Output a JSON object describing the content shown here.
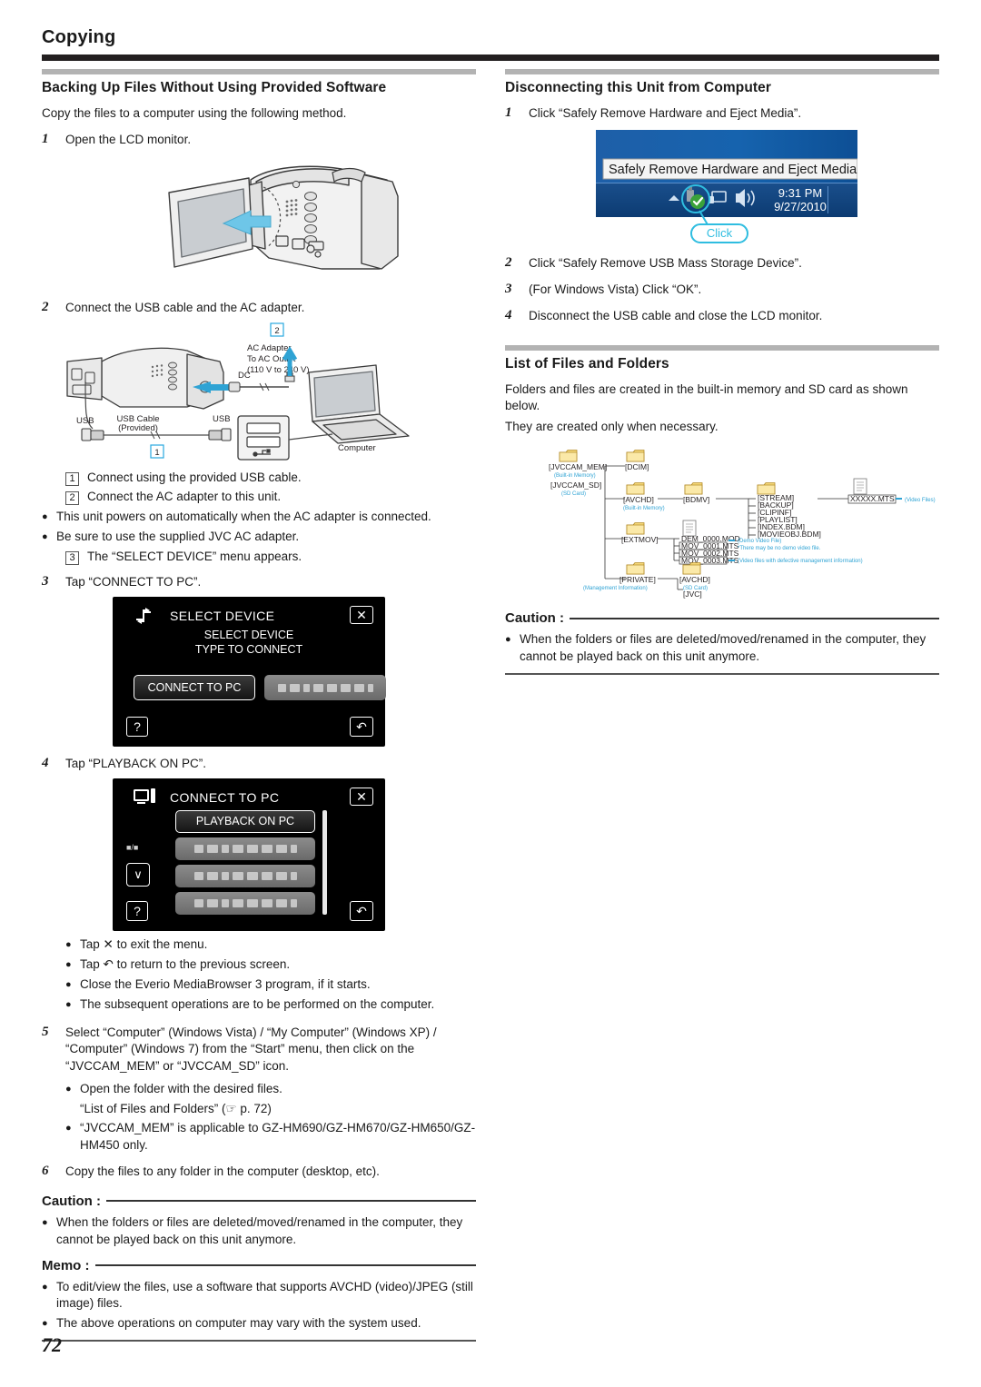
{
  "chapter": {
    "title": "Copying",
    "page_number": "72"
  },
  "left": {
    "section_title": "Backing Up Files Without Using Provided Software",
    "intro": "Copy the files to a computer using the following method.",
    "step1": {
      "num": "1",
      "text": "Open the LCD monitor."
    },
    "step2": {
      "num": "2",
      "text": "Connect the USB cable and the AC adapter."
    },
    "usb_diagram": {
      "badge1": "1",
      "badge2": "2",
      "ac_adapter_l1": "AC Adapter",
      "ac_adapter_l2": "To AC Outlet",
      "ac_adapter_l3": "(110 V to 240 V)",
      "dc": "DC",
      "usb_left": "USB",
      "usb_right": "USB",
      "usb_cable_l1": "USB Cable",
      "usb_cable_l2": "(Provided)",
      "computer": "Computer"
    },
    "substeps": [
      {
        "num": "1",
        "text": "Connect using the provided USB cable."
      },
      {
        "num": "2",
        "text": "Connect the AC adapter to this unit."
      }
    ],
    "bullets_after_substeps": [
      "This unit powers on automatically when the AC adapter is connected.",
      "Be sure to use the supplied JVC AC adapter."
    ],
    "substep3": {
      "num": "3",
      "text": "The “SELECT DEVICE” menu appears."
    },
    "step3": {
      "num": "3",
      "text": "Tap “CONNECT TO PC”."
    },
    "lcd_select_device": {
      "title": "SELECT DEVICE",
      "sub_line1": "SELECT DEVICE",
      "sub_line2": "TYPE TO CONNECT",
      "button": "CONNECT TO PC",
      "close": "✕",
      "back": "↶",
      "help": "?"
    },
    "step4": {
      "num": "4",
      "text": "Tap “PLAYBACK ON PC”."
    },
    "lcd_connect_to_pc": {
      "title": "CONNECT TO PC",
      "button": "PLAYBACK ON PC",
      "page_count": "■/■",
      "down": "∨",
      "close": "✕",
      "back": "↶",
      "help": "?"
    },
    "bullets_after_step4": [
      "Tap ✕ to exit the menu.",
      "Tap ↶ to return to the previous screen.",
      "Close the Everio MediaBrowser 3 program, if it starts.",
      "The subsequent operations are to be performed on the computer."
    ],
    "step5": {
      "num": "5",
      "text": "Select “Computer” (Windows Vista) / “My Computer” (Windows XP) / “Computer” (Windows 7) from the “Start” menu, then click on the “JVCCAM_MEM” or “JVCCAM_SD” icon.",
      "bullet1": "Open the folder with the desired files.",
      "ref": "“List of Files and Folders” (☞ p. 72)",
      "bullet2": "“JVCCAM_MEM” is applicable to GZ-HM690/GZ-HM670/GZ-HM650/GZ-HM450 only."
    },
    "step6": {
      "num": "6",
      "text": "Copy the files to any folder in the computer (desktop, etc)."
    },
    "caution": {
      "head": "Caution :",
      "bullets": [
        "When the folders or files are deleted/moved/renamed in the computer, they cannot be played back on this unit anymore."
      ]
    },
    "memo": {
      "head": "Memo :",
      "bullets": [
        "To edit/view the files, use a software that supports AVCHD (video)/JPEG (still image) files.",
        "The above operations on computer may vary with the system used."
      ]
    }
  },
  "right": {
    "section_title": "Disconnecting this Unit from Computer",
    "step1": {
      "num": "1",
      "text": "Click “Safely Remove Hardware and Eject Media”."
    },
    "windows_graphic": {
      "tooltip": "Safely Remove Hardware and Eject Media",
      "time": "9:31 PM",
      "date": "9/27/2010",
      "callout": "Click"
    },
    "steps": [
      {
        "num": "2",
        "text": "Click “Safely Remove USB Mass Storage Device”."
      },
      {
        "num": "3",
        "text": "(For Windows Vista) Click “OK”."
      },
      {
        "num": "4",
        "text": "Disconnect the USB cable and close the LCD monitor."
      }
    ],
    "files_section_title": "List of Files and Folders",
    "files_intro_1": "Folders and files are created in the built-in memory and SD card as shown below.",
    "files_intro_2": "They are created only when necessary.",
    "tree": {
      "root_mem": "[JVCCAM_MEM]",
      "root_mem_sub": "(Built-in Memory)",
      "root_sd": "[JVCCAM_SD]",
      "root_sd_sub": "(SD Card)",
      "dcim": "[DCIM]",
      "avchd": "[AVCHD]",
      "avchd_sub": "(Built-in Memory)",
      "bdmv": "[BDMV]",
      "bdmv_children": [
        "[STREAM]",
        "[BACKUP]",
        "[CLIPINF]",
        "[PLAYLIST]",
        "[INDEX.BDM]",
        "[MOVIEOBJ.BDM]"
      ],
      "stream_file": "XXXXX.MTS",
      "stream_note": "(Video Files)",
      "extmov": "[EXTMOV]",
      "extmov_files": [
        "DEM_0000.MOD",
        "MOV_0001.MTS",
        "MOV_0002.MTS",
        "MOV_0003.MTS"
      ],
      "extmov_note_1": "(Demo Video File)",
      "extmov_note_1b": "*There may be no demo video file.",
      "extmov_note_2": "(Video files with defective management information)",
      "private": "[PRIVATE]",
      "private_sub": "(Management Information)",
      "private_avchd": "[AVCHD]",
      "private_avchd_sub": "(SD Card)",
      "jvc": "[JVC]"
    },
    "caution": {
      "head": "Caution :",
      "bullets": [
        "When the folders or files are deleted/moved/renamed in the computer, they cannot be played back on this unit anymore."
      ]
    }
  }
}
